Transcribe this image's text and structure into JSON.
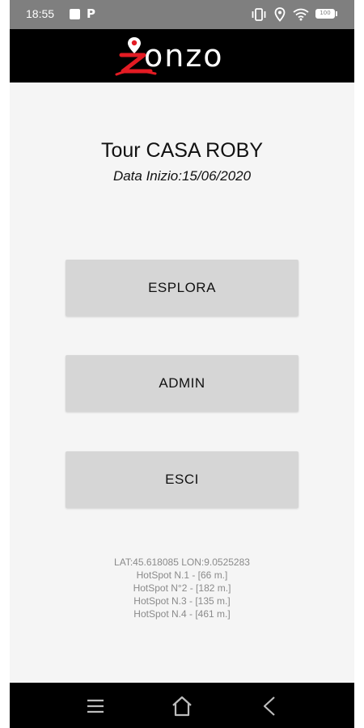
{
  "status_bar": {
    "time": "18:55",
    "battery": "100",
    "icons": [
      "square-notification-icon",
      "p-notification-icon",
      "vibrate-icon",
      "location-icon",
      "wifi-icon",
      "battery-icon"
    ]
  },
  "header": {
    "logo_text": "onzo",
    "logo_icon": "location-pin-z-logo"
  },
  "tour": {
    "title": "Tour CASA ROBY",
    "start_date": "Data Inizio:15/06/2020"
  },
  "buttons": {
    "explore": "ESPLORA",
    "admin": "ADMIN",
    "exit": "ESCI"
  },
  "info": {
    "coords": "LAT:45.618085 LON:9.0525283",
    "hotspots": [
      "HotSpot N.1 - [66 m.]",
      "HotSpot N°2 - [182 m.]",
      "HotSpot N.3 - [135 m.]",
      "HotSpot N.4 - [461 m.]"
    ]
  },
  "nav": {
    "icons": [
      "menu-icon",
      "home-icon",
      "back-icon"
    ]
  },
  "colors": {
    "status_bar": "#7f7f7f",
    "header": "#000000",
    "background": "#f5f5f5",
    "button": "#d6d6d6",
    "logo_accent": "#e31b23",
    "info_text": "#8a8a8a"
  }
}
